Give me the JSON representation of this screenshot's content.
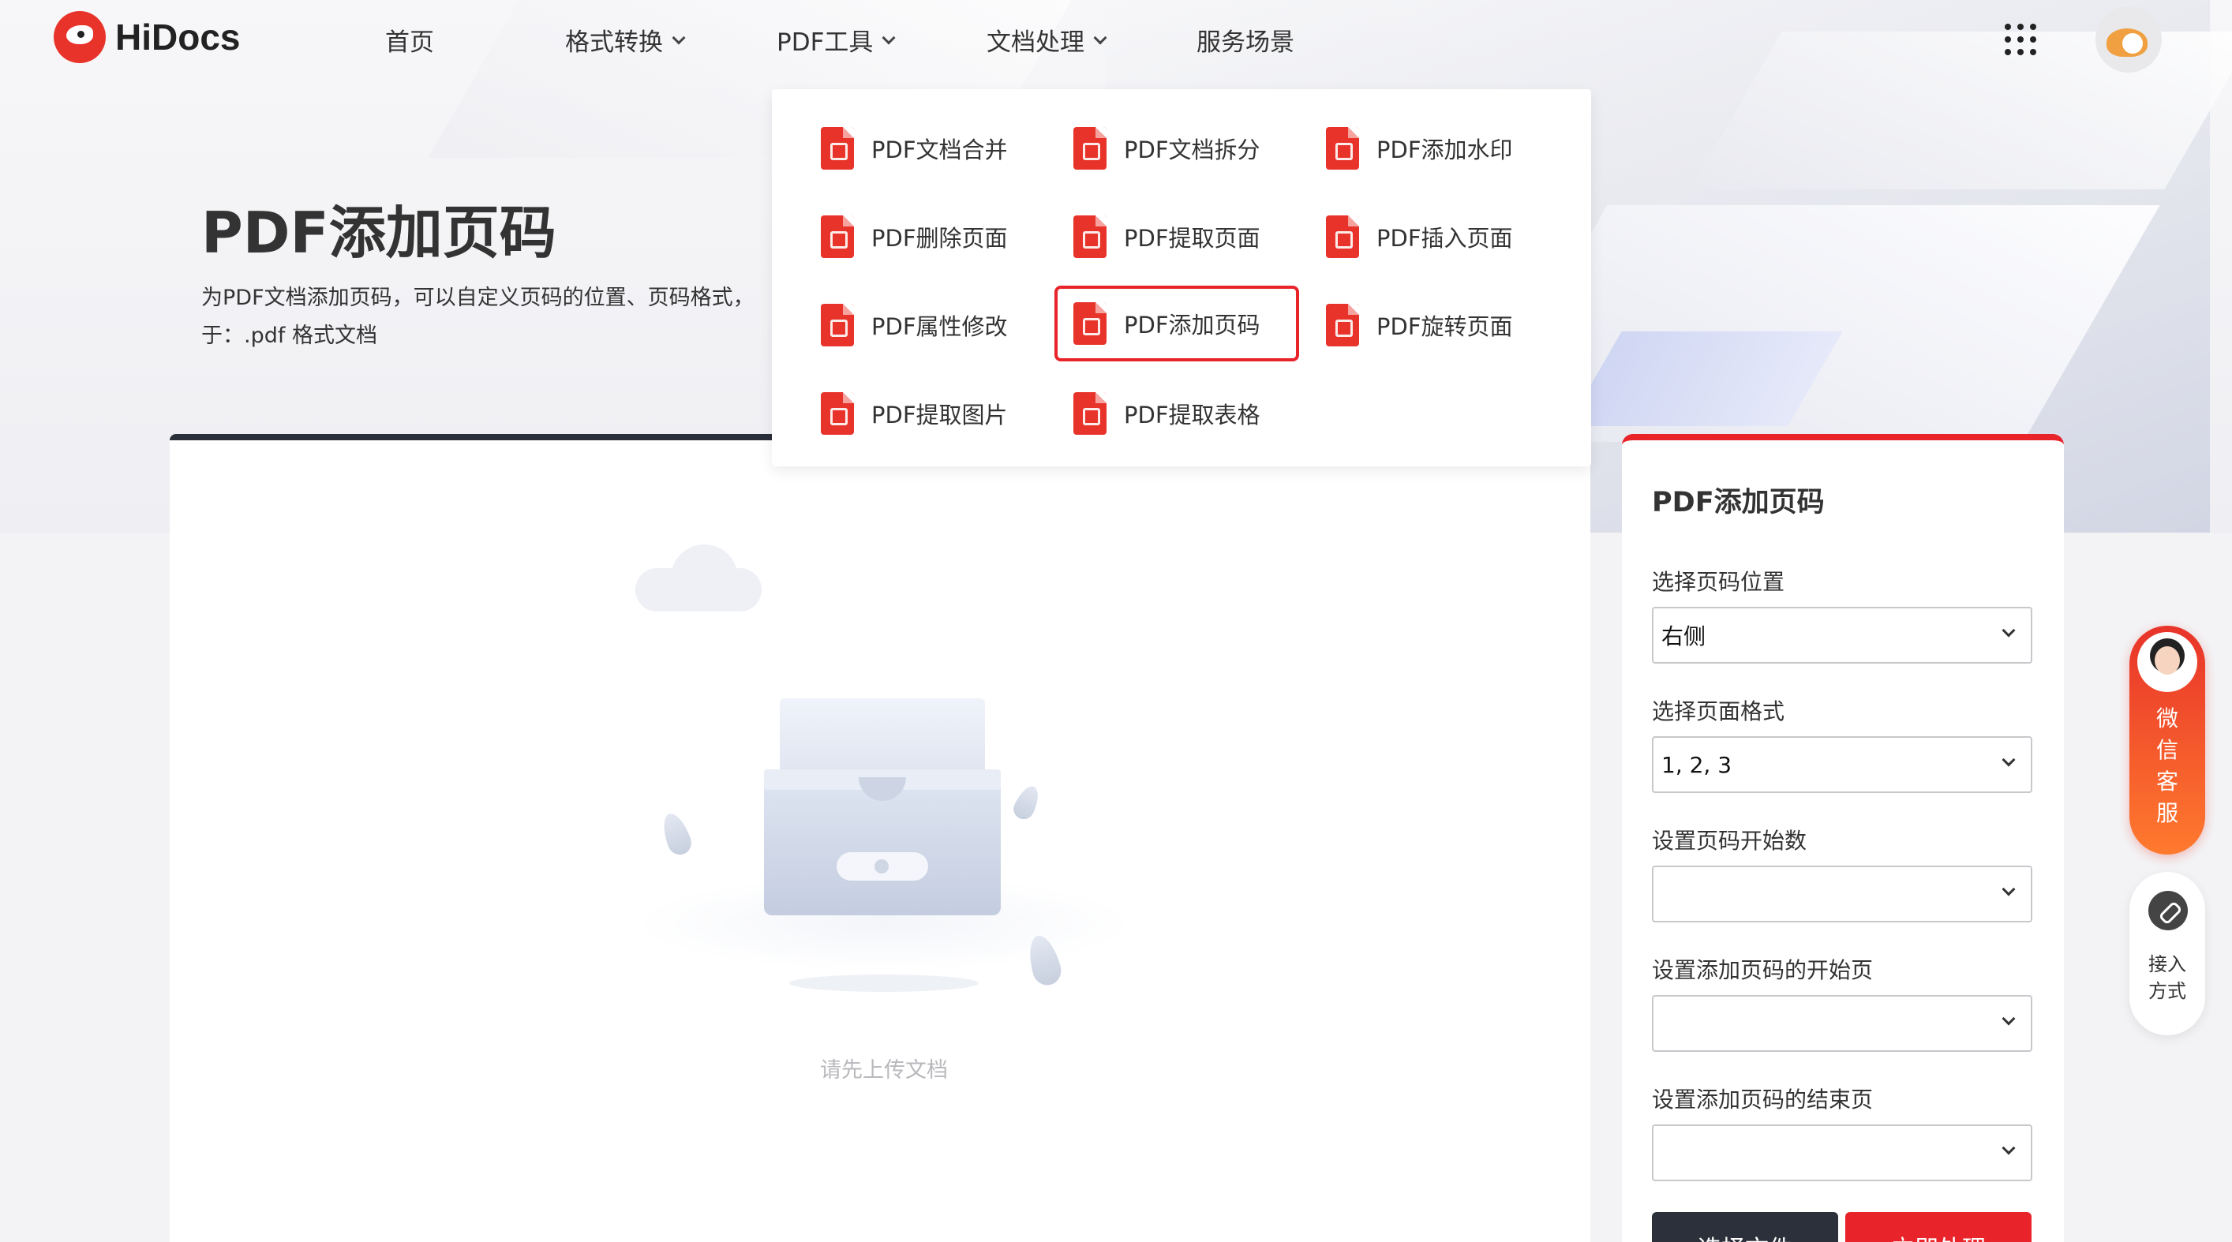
{
  "brand": {
    "name": "HiDocs"
  },
  "nav": {
    "items": [
      {
        "label": "首页"
      },
      {
        "label": "格式转换"
      },
      {
        "label": "PDF工具"
      },
      {
        "label": "文档处理"
      },
      {
        "label": "服务场景"
      }
    ]
  },
  "hero": {
    "title": "PDF添加页码",
    "desc_line1": "为PDF文档添加页码，可以自定义页码的位置、页码格式，",
    "desc_line2": "于：.pdf 格式文档"
  },
  "dropdown": {
    "items": [
      {
        "label": "PDF文档合并"
      },
      {
        "label": "PDF文档拆分"
      },
      {
        "label": "PDF添加水印"
      },
      {
        "label": "PDF删除页面"
      },
      {
        "label": "PDF提取页面"
      },
      {
        "label": "PDF插入页面"
      },
      {
        "label": "PDF属性修改"
      },
      {
        "label": "PDF添加页码"
      },
      {
        "label": "PDF旋转页面"
      },
      {
        "label": "PDF提取图片"
      },
      {
        "label": "PDF提取表格"
      }
    ]
  },
  "main": {
    "empty_text": "请先上传文档"
  },
  "side": {
    "title": "PDF添加页码",
    "position_label": "选择页码位置",
    "position_value": "右侧",
    "format_label": "选择页面格式",
    "format_value": "1, 2, 3",
    "start_num_label": "设置页码开始数",
    "start_num_value": "",
    "start_page_label": "设置添加页码的开始页",
    "start_page_value": "",
    "end_page_label": "设置添加页码的结束页",
    "end_page_value": "",
    "select_file_label": "选择文件",
    "process_label": "立即处理"
  },
  "float": {
    "cs_label": "微信客服",
    "link_label_1": "接入",
    "link_label_2": "方式"
  },
  "colors": {
    "accent": "#e8232a",
    "dark": "#2b303b"
  }
}
